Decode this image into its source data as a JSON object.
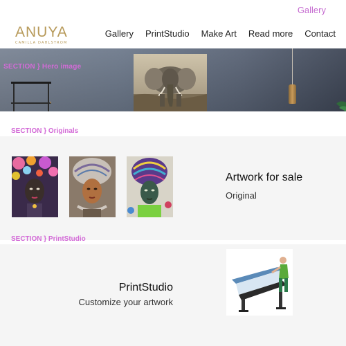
{
  "header": {
    "top_link": "Gallery",
    "logo": {
      "word": "ANUYA",
      "tagline": "CAMILLA DAHLSTROM"
    },
    "nav": [
      {
        "label": "Gallery"
      },
      {
        "label": "PrintStudio"
      },
      {
        "label": "Make Art"
      },
      {
        "label": "Read more"
      },
      {
        "label": "Contact"
      }
    ]
  },
  "hero": {
    "section_label": "SECTION } Hero image"
  },
  "originals": {
    "section_label": "SECTION } Originals",
    "title": "Artwork for sale",
    "subtitle": "Original"
  },
  "printstudio": {
    "section_label": "SECTION } PrintStudio",
    "title": "PrintStudio",
    "subtitle": "Customize your artwork"
  },
  "colors": {
    "accent_pink": "#d36bd7",
    "logo_gold": "#b79a5a",
    "panel_bg": "#f5f5f5"
  }
}
